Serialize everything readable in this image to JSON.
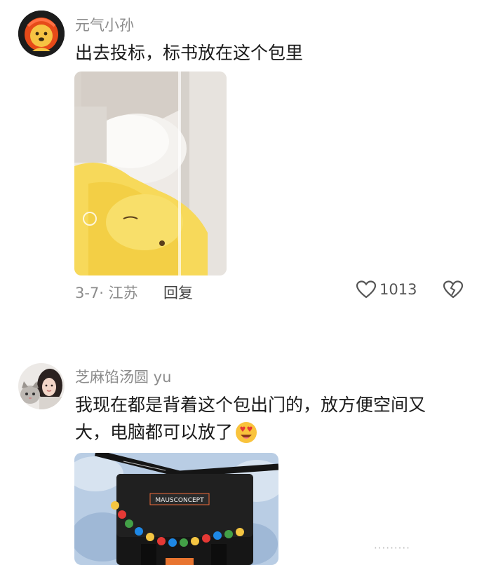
{
  "comments": [
    {
      "username": "元气小孙",
      "text": "出去投标，标书放在这个包里",
      "meta": "3-7· 江苏",
      "reply_label": "回复",
      "likes": "1013",
      "avatar_icon": "lion-avatar-icon",
      "photo_subject": "bag-photo"
    },
    {
      "username": "芝麻馅汤圆 yu",
      "text_line1": "我现在都是背着这个包出门的，放方便空间又",
      "text_line2": "大，电脑都可以放了",
      "emoji_icon": "heart-eyes-emoji-icon",
      "avatar_icon": "girl-with-cat-avatar-icon",
      "photo_subject": "black-messenger-bag-photo",
      "bag_brand_text": "MAUSCONCEPT"
    }
  ],
  "colors": {
    "username": "#8c8c8c",
    "text": "#1a1a1a",
    "meta": "#8c8c8c",
    "accent_yellow": "#f5d94a"
  }
}
